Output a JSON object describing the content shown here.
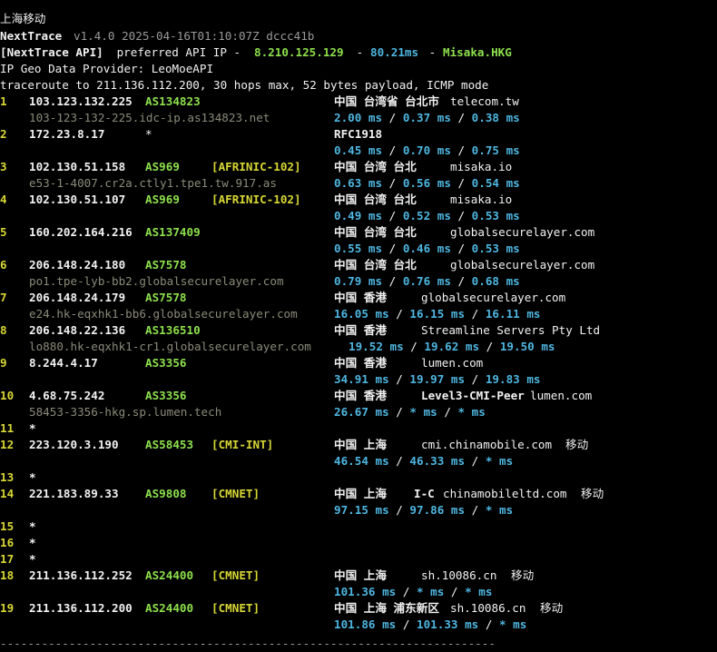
{
  "rules": {
    "top": "------------------------------------------------------------------------",
    "bottom": "------------------------------------------------------------------------"
  },
  "header": {
    "title": "上海移动",
    "app": "NextTrace",
    "version": "v1.4.0 2025-04-16T01:10:07Z dccc41b",
    "api_tag": "[NextTrace API]",
    "api_text": " preferred API IP - ",
    "api_ip": "8.210.125.129",
    "sep1": " - ",
    "api_latency": "80.21ms",
    "sep2": " - ",
    "api_node": "Misaka.HKG",
    "geo_provider": "IP Geo Data Provider: LeoMoeAPI",
    "traceroute": "traceroute to 211.136.112.200, 30 hops max, 52 bytes payload, ICMP mode"
  },
  "hops": [
    {
      "n": "1",
      "ip": "103.123.132.225",
      "asn": "AS134823",
      "tag": "",
      "geo": "中国 台湾省 台北市",
      "org": "telecom.tw",
      "extra": "",
      "host": "103-123-132-225.idc-ip.as134823.net",
      "rtt": [
        "2.00 ms",
        "0.37 ms",
        "0.38 ms"
      ]
    },
    {
      "n": "2",
      "ip": "172.23.8.17",
      "asn": "*",
      "tag": "",
      "geo": "RFC1918",
      "org": "",
      "extra": "",
      "host": "",
      "rtt": [
        "0.45 ms",
        "0.70 ms",
        "0.75 ms"
      ]
    },
    {
      "n": "3",
      "ip": "102.130.51.158",
      "asn": "AS969",
      "tag": "[AFRINIC-102]",
      "geo": "中国 台湾 台北",
      "org": "misaka.io",
      "extra": "",
      "host": "e53-1-4007.cr2a.ctly1.tpe1.tw.917.as",
      "rtt": [
        "0.63 ms",
        "0.56 ms",
        "0.54 ms"
      ]
    },
    {
      "n": "4",
      "ip": "102.130.51.107",
      "asn": "AS969",
      "tag": "[AFRINIC-102]",
      "geo": "中国 台湾 台北",
      "org": "misaka.io",
      "extra": "",
      "host": "",
      "rtt": [
        "0.49 ms",
        "0.52 ms",
        "0.53 ms"
      ]
    },
    {
      "n": "5",
      "ip": "160.202.164.216",
      "asn": "AS137409",
      "tag": "",
      "geo": "中国 台湾 台北",
      "org": "globalsecurelayer.com",
      "extra": "",
      "host": "",
      "rtt": [
        "0.55 ms",
        "0.46 ms",
        "0.53 ms"
      ]
    },
    {
      "n": "6",
      "ip": "206.148.24.180",
      "asn": "AS7578",
      "tag": "",
      "geo": "中国 台湾 台北",
      "org": "globalsecurelayer.com",
      "extra": "",
      "host": "po1.tpe-lyb-bb2.globalsecurelayer.com",
      "rtt": [
        "0.79 ms",
        "0.76 ms",
        "0.68 ms"
      ]
    },
    {
      "n": "7",
      "ip": "206.148.24.179",
      "asn": "AS7578",
      "tag": "",
      "geo": "中国 香港",
      "org": "globalsecurelayer.com",
      "extra": "",
      "host": "e24.hk-eqxhk1-bb6.globalsecurelayer.com",
      "rtt": [
        "16.05 ms",
        "16.15 ms",
        "16.11 ms"
      ]
    },
    {
      "n": "8",
      "ip": "206.148.22.136",
      "asn": "AS136510",
      "tag": "",
      "geo": "中国 香港",
      "org": "Streamline Servers Pty Ltd",
      "extra": "",
      "host": "lo880.hk-eqxhk1-cr1.globalsecurelayer.com",
      "rtt": [
        "19.52 ms",
        "19.62 ms",
        "19.50 ms"
      ]
    },
    {
      "n": "9",
      "ip": "8.244.4.17",
      "asn": "AS3356",
      "tag": "",
      "geo": "中国 香港",
      "org": "lumen.com",
      "extra": "",
      "host": "",
      "rtt": [
        "34.91 ms",
        "19.97 ms",
        "19.83 ms"
      ]
    },
    {
      "n": "10",
      "ip": "4.68.75.242",
      "asn": "AS3356",
      "tag": "",
      "geo": "中国 香港",
      "org": "lumen.com",
      "label": "Level3-CMI-Peer",
      "extra": "",
      "host": "58453-3356-hkg.sp.lumen.tech",
      "rtt": [
        "26.67 ms",
        "* ms",
        "* ms"
      ]
    },
    {
      "n": "11",
      "ip": "*",
      "asn": "",
      "tag": "",
      "geo": "",
      "org": "",
      "extra": "",
      "host": "",
      "rtt": []
    },
    {
      "n": "12",
      "ip": "223.120.3.190",
      "asn": "AS58453",
      "tag": "[CMI-INT]",
      "geo": "中国 上海",
      "org": "cmi.chinamobile.com",
      "extra": "移动",
      "host": "",
      "rtt": [
        "46.54 ms",
        "46.33 ms",
        "* ms"
      ]
    },
    {
      "n": "13",
      "ip": "*",
      "asn": "",
      "tag": "",
      "geo": "",
      "org": "",
      "extra": "",
      "host": "",
      "rtt": []
    },
    {
      "n": "14",
      "ip": "221.183.89.33",
      "asn": "AS9808",
      "tag": "[CMNET]",
      "geo": "中国 上海",
      "org": "chinamobileltd.com",
      "label": "I-C",
      "extra": "移动",
      "host": "",
      "rtt": [
        "97.15 ms",
        "97.86 ms",
        "* ms"
      ]
    },
    {
      "n": "15",
      "ip": "*",
      "asn": "",
      "tag": "",
      "geo": "",
      "org": "",
      "extra": "",
      "host": "",
      "rtt": []
    },
    {
      "n": "16",
      "ip": "*",
      "asn": "",
      "tag": "",
      "geo": "",
      "org": "",
      "extra": "",
      "host": "",
      "rtt": []
    },
    {
      "n": "17",
      "ip": "*",
      "asn": "",
      "tag": "",
      "geo": "",
      "org": "",
      "extra": "",
      "host": "",
      "rtt": []
    },
    {
      "n": "18",
      "ip": "211.136.112.252",
      "asn": "AS24400",
      "tag": "[CMNET]",
      "geo": "中国 上海",
      "org": "sh.10086.cn",
      "extra": "移动",
      "host": "",
      "rtt": [
        "101.36 ms",
        "* ms",
        "* ms"
      ]
    },
    {
      "n": "19",
      "ip": "211.136.112.200",
      "asn": "AS24400",
      "tag": "[CMNET]",
      "geo": "中国 上海 浦东新区",
      "org": "sh.10086.cn",
      "extra": "移动",
      "host": "",
      "rtt": [
        "101.86 ms",
        "101.33 ms",
        "* ms"
      ]
    }
  ],
  "colors": {
    "background": "#000000",
    "hop_number": "#d7d736",
    "asn": "#8ee04d",
    "tag": "#d7d736",
    "rtt": "#4fb6e0",
    "hostname": "#8a8a7a",
    "text": "#f2f2f2"
  }
}
